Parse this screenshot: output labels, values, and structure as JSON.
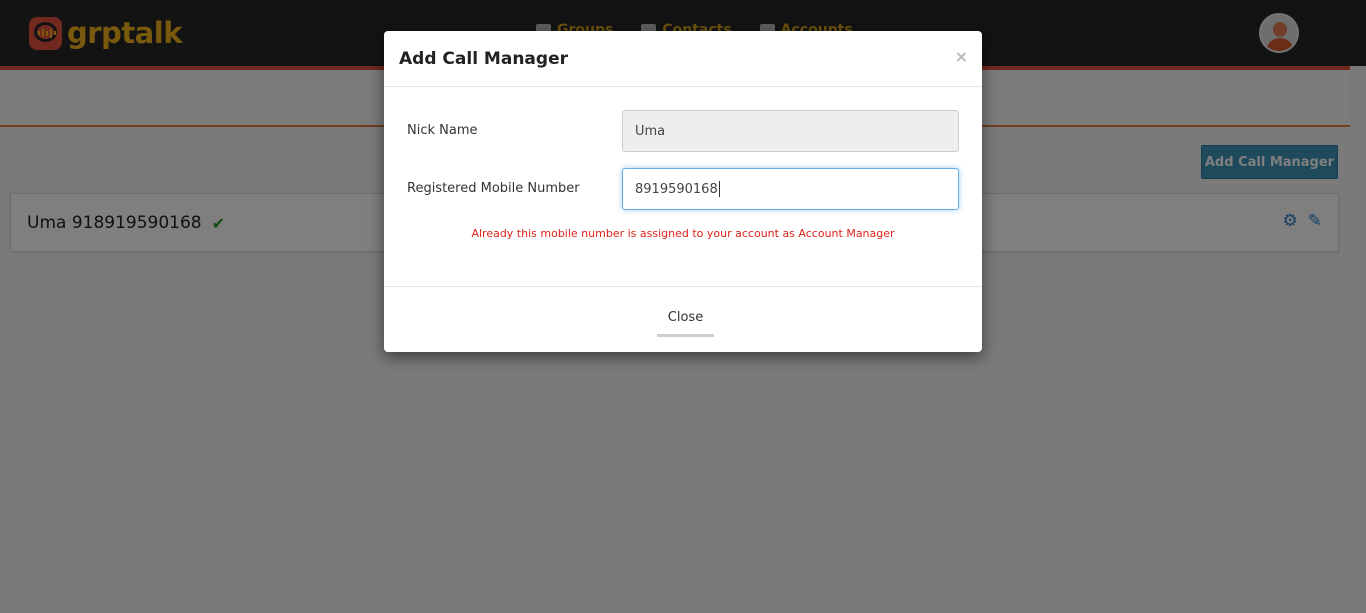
{
  "header": {
    "logo_text": "grptalk",
    "nav": [
      {
        "label": "Groups",
        "icon": "group-icon"
      },
      {
        "label": "Contacts",
        "icon": "contacts-icon"
      },
      {
        "label": "Accounts",
        "icon": "user-icon"
      }
    ],
    "avatar_icon": "user-avatar-icon"
  },
  "page": {
    "add_button_label": "Add Call Manager",
    "card": {
      "name": "Uma 918919590168",
      "verified_icon": "check-icon",
      "settings_icon": "gear-icon",
      "edit_icon": "pencil-icon"
    }
  },
  "modal": {
    "title": "Add Call Manager",
    "close_symbol": "×",
    "nick_name_label": "Nick Name",
    "nick_name_value": "Uma",
    "mobile_label": "Registered Mobile Number",
    "mobile_value": "8919590168",
    "error": "Already this mobile number is assigned to your account as Account Manager",
    "close_button_label": "Close"
  },
  "colors": {
    "header_bg": "#272727",
    "accent_red": "#e2513f",
    "logo_yellow": "#f2b21b",
    "button_blue": "#3e95b8",
    "error_red": "#e0231c",
    "check_green": "#1f9c28"
  }
}
